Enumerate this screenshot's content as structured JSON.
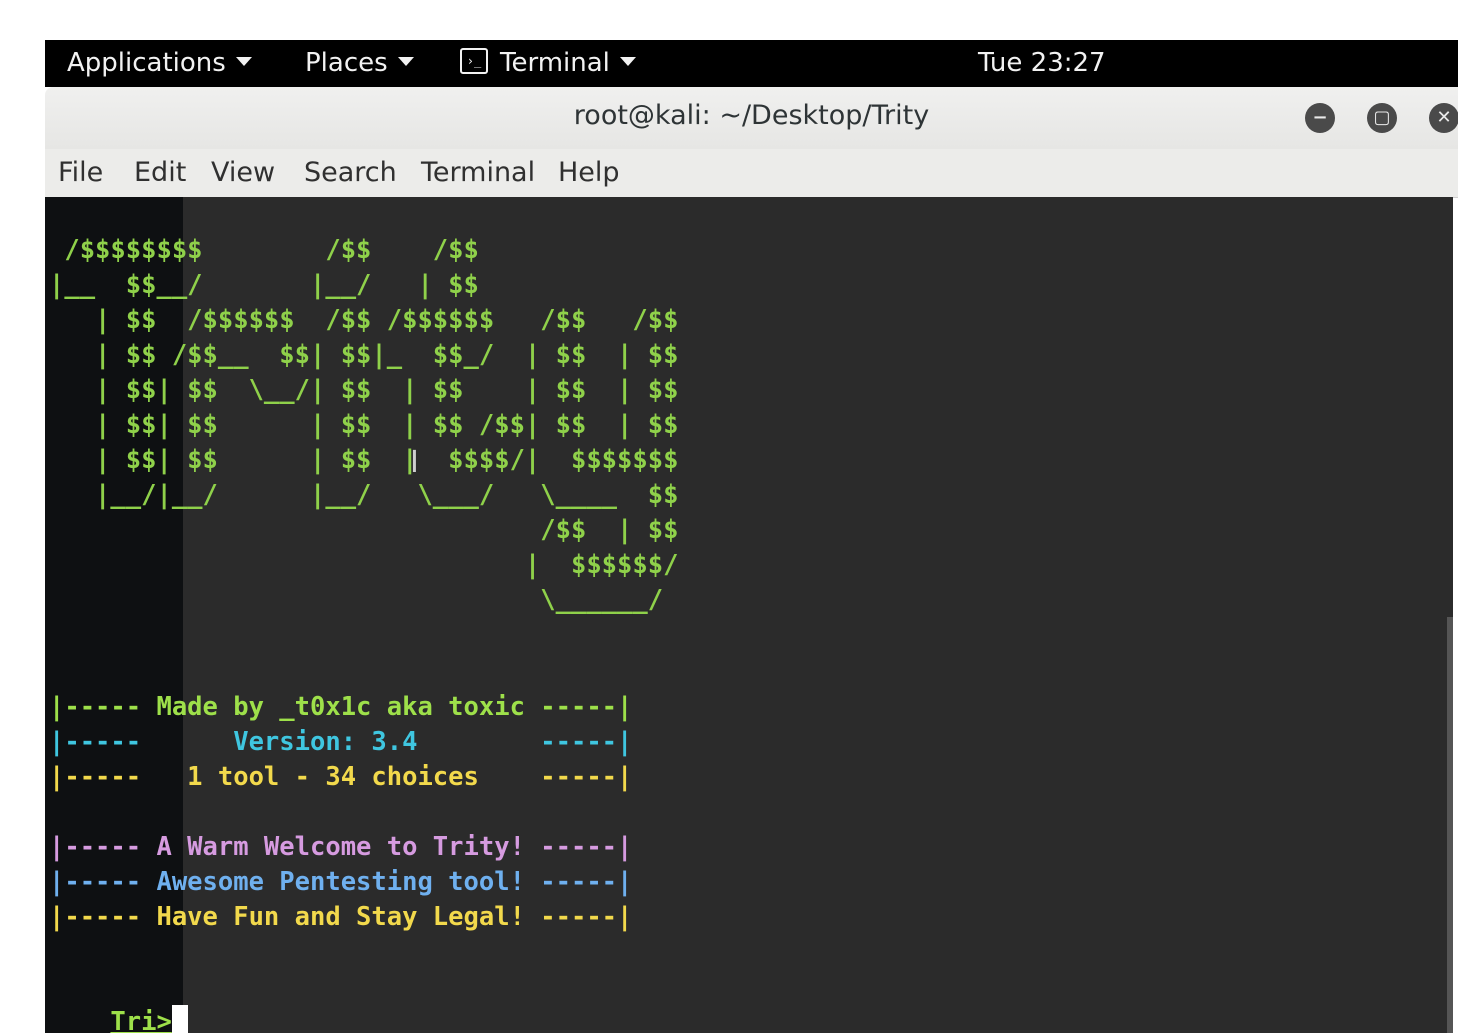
{
  "panel": {
    "applications": "Applications",
    "places": "Places",
    "terminal": "Terminal",
    "clock": "Tue 23:27"
  },
  "window": {
    "title": "root@kali: ~/Desktop/Trity",
    "minimize": "−",
    "maximize": "▢",
    "close": "✕"
  },
  "menubar": {
    "file": "File",
    "edit": "Edit",
    "view": "View",
    "search": "Search",
    "terminal": "Terminal",
    "help": "Help"
  },
  "terminal": {
    "art": [
      " /$$$$$$$$        /$$    /$$",
      "|__  $$__/       |__/   | $$",
      "   | $$  /$$$$$$  /$$ /$$$$$$   /$$   /$$",
      "   | $$ /$$__  $$| $$|_  $$_/  | $$  | $$",
      "   | $$| $$  \\__/| $$  | $$    | $$  | $$",
      "   | $$| $$      | $$  | $$ /$$| $$  | $$",
      "   | $$| $$      | $$  |  $$$$/|  $$$$$$$",
      "   |__/|__/      |__/   \\___/   \\____  $$",
      "                                /$$  | $$",
      "                               |  $$$$$$/",
      "                                \\______/"
    ],
    "banner1": "|----- Made by _t0x1c aka toxic -----|",
    "banner2": "|-----      Version: 3.4        -----|",
    "banner3": "|-----   1 tool - 34 choices    -----|",
    "welcome1": "|----- A Warm Welcome to Trity! -----|",
    "welcome2": "|----- Awesome Pentesting tool! -----|",
    "welcome3": "|----- Have Fun and Stay Legal! -----|",
    "prompt": "Tri>"
  },
  "colors": {
    "art": "#8fd14a",
    "green": "#9ee04a",
    "cyan": "#3fc6e0",
    "yellow": "#f2d94c",
    "pink": "#d69be0",
    "blue": "#6fb0ef"
  }
}
